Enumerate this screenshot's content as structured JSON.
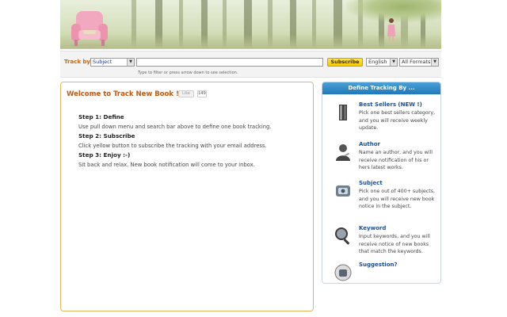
{
  "banner": {
    "logo": "armchair-illustration"
  },
  "search": {
    "track_by_label": "Track by",
    "track_by_value": "Subject",
    "query_value": "",
    "subscribe_label": "Subscribe",
    "language_value": "English",
    "format_value": "All Formats",
    "hint": "Type to filter or press arrow down to see selection."
  },
  "main": {
    "title": "Welcome to Track New Book !",
    "like_label": "Like",
    "like_count": "149",
    "steps": [
      {
        "heading": "Step 1: Define",
        "text": "Use pull down menu and search bar above to define one book tracking."
      },
      {
        "heading": "Step 2: Subscribe",
        "text": "Click yellow button to subscribe the tracking with your email address."
      },
      {
        "heading": "Step 3: Enjoy :-)",
        "text": "Sit back and relax. New book notification will come to your inbox."
      }
    ]
  },
  "side": {
    "title": "Define Tracking By ...",
    "items": [
      {
        "title": "Best Sellers (NEW !)",
        "desc": "Pick one best sellers category, and you will receive weekly update.",
        "icon": "book-stack-icon"
      },
      {
        "title": "Author",
        "desc": "Name an author, and you will receive notification of his or hers latest works.",
        "icon": "author-icon"
      },
      {
        "title": "Subject",
        "desc": "Pick one out of 400+ subjects, and you will receive new book notice in the subject.",
        "icon": "subject-icon"
      },
      {
        "title": "Keyword",
        "desc": "Input keywords, and you will receive notice of new books that match the keywords.",
        "icon": "magnifier-icon"
      },
      {
        "title": "Suggestion?",
        "desc": "",
        "icon": "suggestion-icon"
      }
    ]
  },
  "colors": {
    "accent": "#c05a12",
    "subscribe": "#f6c900",
    "side_header": "#1f78b8",
    "link": "#1a4f9a"
  }
}
